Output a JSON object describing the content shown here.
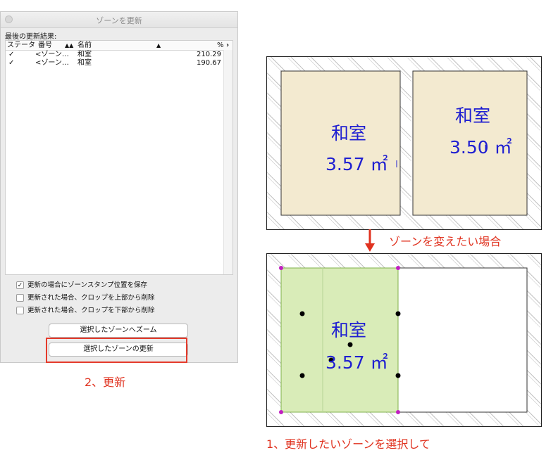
{
  "dialog": {
    "title": "ゾーンを更新",
    "section_label": "最後の更新結果:",
    "columns": {
      "status": "ステータ",
      "number": "番号",
      "sort_icon": "▲▲",
      "name": "名前",
      "sort_icon2": "▲",
      "percent": "%",
      "more": "›"
    },
    "rows": [
      {
        "check": "✓",
        "number": "<ゾーン…",
        "name": "和室",
        "percent": "210.29"
      },
      {
        "check": "✓",
        "number": "<ゾーン…",
        "name": "和室",
        "percent": "190.67"
      }
    ],
    "options": [
      {
        "checked": true,
        "label": "更新の場合にゾーンスタンプ位置を保存"
      },
      {
        "checked": false,
        "label": "更新された場合、クロップを上部から削除"
      },
      {
        "checked": false,
        "label": "更新された場合、クロップを下部から削除"
      }
    ],
    "buttons": {
      "zoom": "選択したゾーンへズーム",
      "update": "選択したゾーンの更新"
    }
  },
  "annotations": {
    "step2": "2、更新",
    "change_note": "ゾーンを変えたい場合",
    "step1": "1、更新したいゾーンを選択して"
  },
  "plan_top": {
    "rooms": [
      {
        "name": "和室",
        "area": "3.57 ㎡"
      },
      {
        "name": "和室",
        "area": "3.50 ㎡"
      }
    ]
  },
  "plan_bottom": {
    "room": {
      "name": "和室",
      "area": "3.57 ㎡"
    }
  },
  "colors": {
    "room_fill": "#f3ead0",
    "selected_zone_fill": "#d9ecb8",
    "label_blue": "#1f1fd1",
    "annotation_red": "#e0321f",
    "handle_magenta": "#c020c0"
  }
}
